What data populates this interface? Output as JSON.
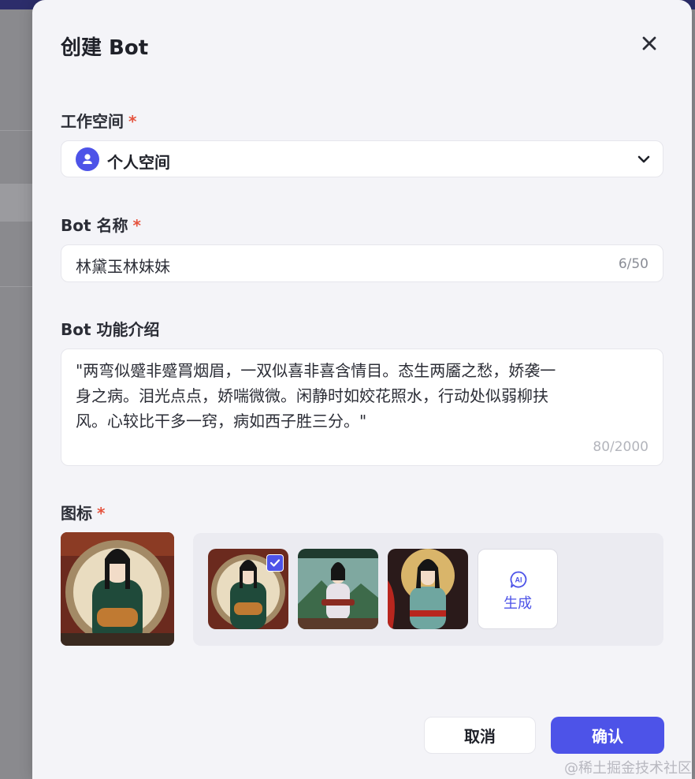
{
  "modal": {
    "title": "创建 Bot"
  },
  "workspace": {
    "label": "工作空间",
    "required_mark": "*",
    "value": "个人空间"
  },
  "bot_name": {
    "label": "Bot 名称",
    "required_mark": "*",
    "value": "林黛玉林妹妹",
    "count": "6/50"
  },
  "bot_description": {
    "label": "Bot 功能介绍",
    "lines": [
      "\"两弯似蹙非蹙罥烟眉，一双似喜非喜含情目。态生两靥之愁，娇袭一",
      "身之病。泪光点点，娇喘微微。闲静时如姣花照水，行动处似弱柳扶",
      "风。心较比干多一窍，病如西子胜三分。\""
    ],
    "count": "80/2000"
  },
  "icon": {
    "label": "图标",
    "required_mark": "*",
    "ai_generate_label": "生成",
    "ai_badge_text": "AI"
  },
  "actions": {
    "cancel_label": "取消",
    "confirm_label": "确认"
  },
  "watermark": "@稀土掘金技术社区",
  "colors": {
    "accent": "#4d53e8",
    "required": "#e5533e"
  }
}
